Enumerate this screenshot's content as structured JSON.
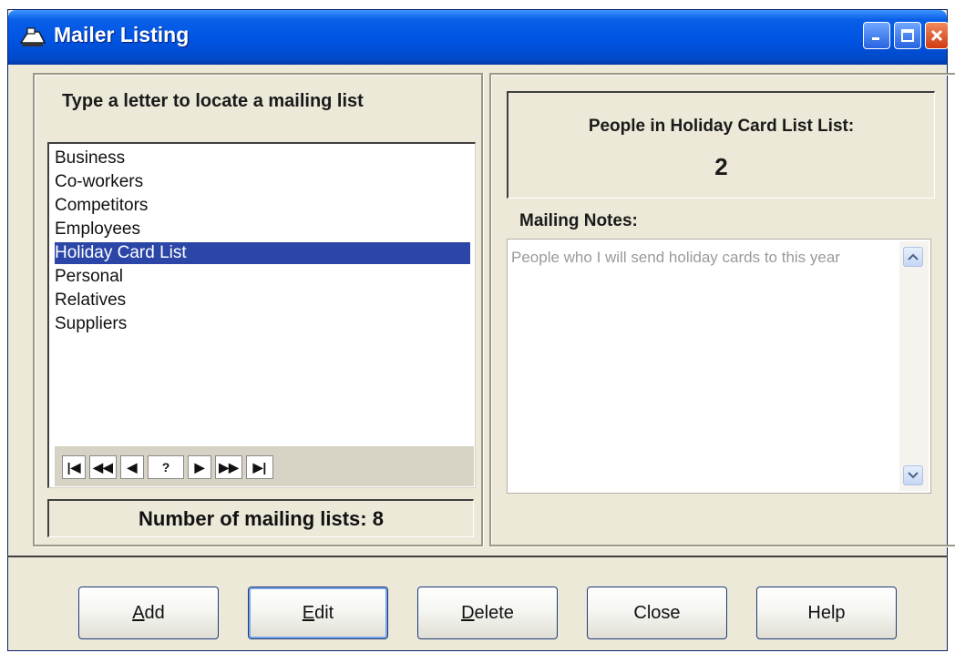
{
  "window": {
    "title": "Mailer Listing",
    "min_glyph": "_",
    "max_glyph": "□",
    "close_glyph": "✕"
  },
  "left": {
    "locate_label": "Type a letter to locate a mailing list",
    "lists": [
      {
        "label": "Business"
      },
      {
        "label": "Co-workers"
      },
      {
        "label": "Competitors"
      },
      {
        "label": "Employees"
      },
      {
        "label": "Holiday Card List",
        "selected": true
      },
      {
        "label": "Personal"
      },
      {
        "label": "Relatives"
      },
      {
        "label": "Suppliers"
      }
    ],
    "nav_buttons": [
      "|◀",
      "◀◀",
      "◀",
      "?",
      "▶",
      "▶▶",
      "▶|"
    ],
    "count_label": "Number of mailing lists: 8"
  },
  "right": {
    "people_label": "People in Holiday Card List List:",
    "people_count": "2",
    "notes_label": "Mailing Notes:",
    "notes_text": "People who I will send holiday cards to this year"
  },
  "buttons": {
    "add": {
      "mnemonic": "A",
      "rest": "dd"
    },
    "edit": {
      "mnemonic": "E",
      "rest": "dit"
    },
    "delete": {
      "mnemonic": "D",
      "rest": "elete"
    },
    "close": "Close",
    "help": "Help"
  },
  "colors": {
    "selection": "#2b46a6",
    "titlebar": "#0054e3",
    "dialog_bg": "#ece9d8"
  }
}
